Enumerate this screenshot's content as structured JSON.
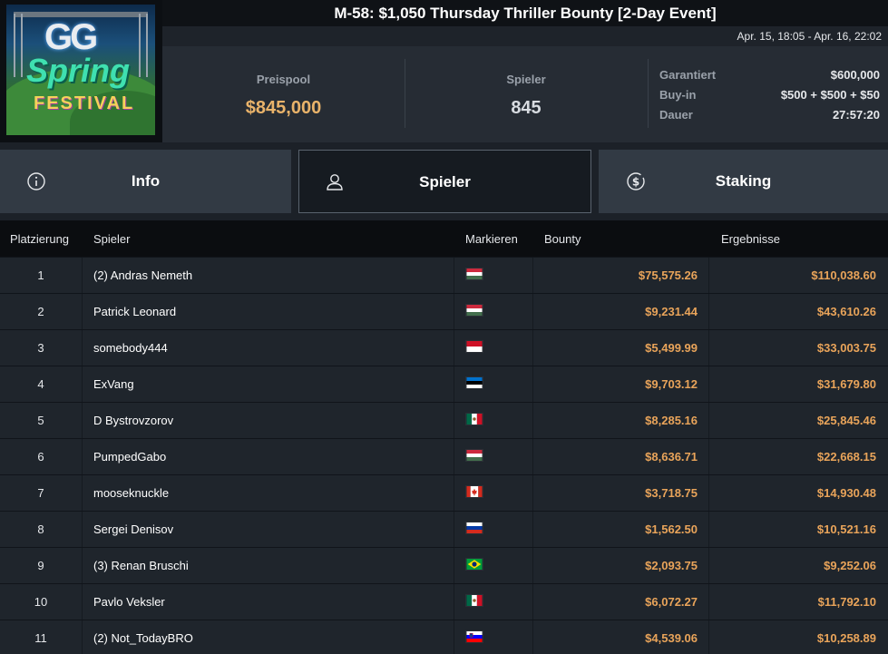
{
  "header": {
    "title": "M-58: $1,050 Thursday Thriller Bounty [2-Day Event]",
    "date_range": "Apr. 15, 18:05 - Apr. 16, 22:02"
  },
  "logo": {
    "line1": "GG",
    "line2": "Spring",
    "line3": "FESTIVAL"
  },
  "stats": {
    "prize_pool_label": "Preispool",
    "prize_pool_value": "$845,000",
    "players_label": "Spieler",
    "players_value": "845",
    "guaranteed_label": "Garantiert",
    "guaranteed_value": "$600,000",
    "buyin_label": "Buy-in",
    "buyin_value": "$500 + $500 + $50",
    "duration_label": "Dauer",
    "duration_value": "27:57:20"
  },
  "tabs": [
    {
      "label": "Info",
      "icon": "info-icon",
      "active": false
    },
    {
      "label": "Spieler",
      "icon": "user-icon",
      "active": true
    },
    {
      "label": "Staking",
      "icon": "dollar-coin-icon",
      "active": false
    }
  ],
  "table": {
    "columns": [
      "Platzierung",
      "Spieler",
      "Markieren",
      "Bounty",
      "Ergebnisse"
    ],
    "rows": [
      {
        "rank": "1",
        "player": "(2) Andras Nemeth",
        "flag": "hungary",
        "bounty": "$75,575.26",
        "result": "$110,038.60"
      },
      {
        "rank": "2",
        "player": "Patrick Leonard",
        "flag": "hungary",
        "bounty": "$9,231.44",
        "result": "$43,610.26"
      },
      {
        "rank": "3",
        "player": "somebody444",
        "flag": "indonesia",
        "bounty": "$5,499.99",
        "result": "$33,003.75"
      },
      {
        "rank": "4",
        "player": "ExVang",
        "flag": "estonia",
        "bounty": "$9,703.12",
        "result": "$31,679.80"
      },
      {
        "rank": "5",
        "player": "D Bystrovzorov",
        "flag": "mexico",
        "bounty": "$8,285.16",
        "result": "$25,845.46"
      },
      {
        "rank": "6",
        "player": "PumpedGabo",
        "flag": "hungary",
        "bounty": "$8,636.71",
        "result": "$22,668.15"
      },
      {
        "rank": "7",
        "player": "mooseknuckle",
        "flag": "canada",
        "bounty": "$3,718.75",
        "result": "$14,930.48"
      },
      {
        "rank": "8",
        "player": "Sergei Denisov",
        "flag": "russia",
        "bounty": "$1,562.50",
        "result": "$10,521.16"
      },
      {
        "rank": "9",
        "player": "(3) Renan Bruschi",
        "flag": "brazil",
        "bounty": "$2,093.75",
        "result": "$9,252.06"
      },
      {
        "rank": "10",
        "player": "Pavlo Veksler",
        "flag": "mexico",
        "bounty": "$6,072.27",
        "result": "$11,792.10"
      },
      {
        "rank": "11",
        "player": "(2) Not_TodayBRO",
        "flag": "slovenia",
        "bounty": "$4,539.06",
        "result": "$10,258.89"
      }
    ]
  },
  "colors": {
    "accent_gold": "#e9b36a",
    "amount_orange": "#e9a45a",
    "panel_dark": "#0f1216",
    "tab_inactive": "#323a44"
  }
}
